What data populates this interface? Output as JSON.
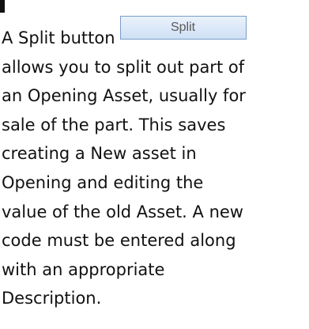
{
  "paragraph": {
    "line_1_prefix": "A Split button",
    "button_label": "Split",
    "lines": [
      "allows you to split out part of",
      "an Opening Asset, usually for",
      "sale of the part. This saves",
      "creating a New asset in",
      "Opening and editing the",
      "value of the old Asset. A new",
      "code must be entered along",
      "with an appropriate",
      "Description."
    ]
  }
}
